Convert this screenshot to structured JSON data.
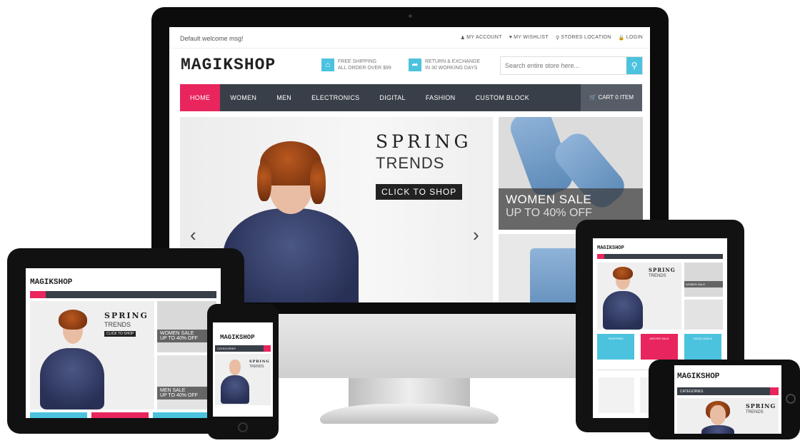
{
  "imac": {
    "topbar": {
      "welcome": "Default welcome msg!",
      "links": [
        {
          "icon": "user-icon",
          "glyph": "♟",
          "label": "MY ACCOUNT"
        },
        {
          "icon": "heart-icon",
          "glyph": "♥",
          "label": "MY WISHLIST"
        },
        {
          "icon": "map-pin-icon",
          "glyph": "⚲",
          "label": "STORES LOCATION"
        },
        {
          "icon": "lock-icon",
          "glyph": "🔒",
          "label": "LOGIN"
        }
      ]
    },
    "logo": "MAGIKSHOP",
    "features": [
      {
        "icon": "home-icon",
        "glyph": "⌂",
        "line1": "FREE SHIPPING",
        "line2": "ALL ORDER OVER $99"
      },
      {
        "icon": "share-arrow-icon",
        "glyph": "➦",
        "line1": "RETURN & EXCHANGE",
        "line2": "IN 30 WORKING DAYS"
      }
    ],
    "search": {
      "placeholder": "Search entire store here...",
      "icon": "search-icon",
      "glyph": "⚲"
    },
    "nav": [
      "HOME",
      "WOMEN",
      "MEN",
      "ELECTRONICS",
      "DIGITAL",
      "FASHION",
      "CUSTOM BLOCK"
    ],
    "cart": {
      "icon": "cart-icon",
      "glyph": "🛒",
      "label": "CART 0 ITEM"
    },
    "hero": {
      "title": "SPRING",
      "subtitle": "TRENDS",
      "button": "CLICK TO SHOP",
      "prev_glyph": "‹",
      "next_glyph": "›"
    },
    "side_banner": {
      "title": "WOMEN SALE",
      "subtitle": "UP TO 40% OFF"
    }
  },
  "apple_glyph": "",
  "tablet": {
    "logo": "MAGIKSHOP",
    "hero_title": "SPRING",
    "hero_subtitle": "TRENDS",
    "hero_button": "CLICK TO SHOP",
    "sale_top": "WOMEN SALE",
    "sale_top_sub": "UP TO 40% OFF",
    "sale_bottom": "MEN SALE",
    "sale_bottom_sub": "UP TO 40% OFF"
  },
  "phone": {
    "logo": "MAGIKSHOP",
    "categories": "CATEGORIES",
    "hero_title": "SPRING",
    "hero_subtitle": "TRENDS"
  },
  "tablet2": {
    "logo": "MAGIKSHOP",
    "hero_title": "SPRING",
    "hero_subtitle": "TRENDS",
    "sale_top": "WOMEN SALE",
    "tiles": [
      {
        "label": "SHOPPING",
        "color": "#4cc3de"
      },
      {
        "label": "WINTER SALE",
        "color": "#e9255e"
      },
      {
        "label": "GOOD DEALS",
        "color": "#4cc3de"
      }
    ]
  },
  "phone2": {
    "logo": "MAGIKSHOP",
    "categories": "CATEGORIES",
    "hero_title": "SPRING",
    "hero_subtitle": "TRENDS"
  },
  "colors": {
    "accent_pink": "#e9255e",
    "accent_blue": "#4cc3de",
    "nav_dark": "#393f48"
  }
}
